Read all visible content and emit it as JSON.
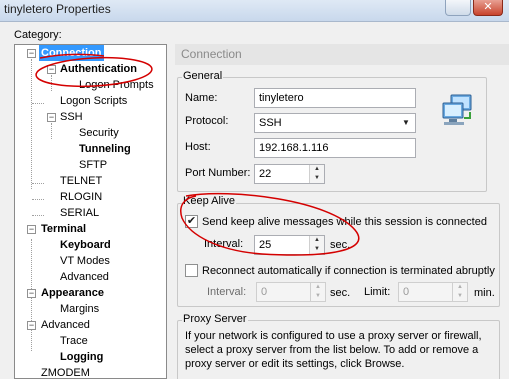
{
  "window": {
    "title": "tinyletero Properties",
    "close_symbol": "✕"
  },
  "category_label": "Category:",
  "tree": {
    "connection": "Connection",
    "authentication": "Authentication",
    "logon_prompts": "Logon Prompts",
    "logon_scripts": "Logon Scripts",
    "ssh": "SSH",
    "security": "Security",
    "tunneling": "Tunneling",
    "sftp": "SFTP",
    "telnet": "TELNET",
    "rlogin": "RLOGIN",
    "serial": "SERIAL",
    "terminal": "Terminal",
    "keyboard": "Keyboard",
    "vt_modes": "VT Modes",
    "advanced_term": "Advanced",
    "appearance": "Appearance",
    "margins": "Margins",
    "advanced": "Advanced",
    "trace": "Trace",
    "logging": "Logging",
    "zmodem": "ZMODEM"
  },
  "panel": {
    "title": "Connection",
    "general": {
      "label": "General",
      "name_label": "Name:",
      "name_value": "tinyletero",
      "protocol_label": "Protocol:",
      "protocol_value": "SSH",
      "host_label": "Host:",
      "host_value": "192.168.1.116",
      "port_label": "Port Number:",
      "port_value": "22"
    },
    "keep_alive": {
      "label": "Keep Alive",
      "send_checkbox_label": "Send keep alive messages while this session is connected",
      "send_checked": true,
      "interval_label": "Interval:",
      "interval_value": "25",
      "sec_label": "sec.",
      "reconnect_label": "Reconnect automatically if connection is terminated abruptly",
      "reconnect_checked": false,
      "reconnect_interval_label": "Interval:",
      "reconnect_interval_value": "0",
      "reconnect_sec_label": "sec.",
      "limit_label": "Limit:",
      "limit_value": "0",
      "min_label": "min."
    },
    "proxy": {
      "label": "Proxy Server",
      "text_line1": "If your network is configured to use a proxy server or firewall,",
      "text_line2": "select a proxy server from the list below. To add or remove a",
      "text_line3": "proxy server or edit its settings, click Browse."
    }
  },
  "colors": {
    "selection": "#3399ff",
    "annotation": "#d40000"
  }
}
